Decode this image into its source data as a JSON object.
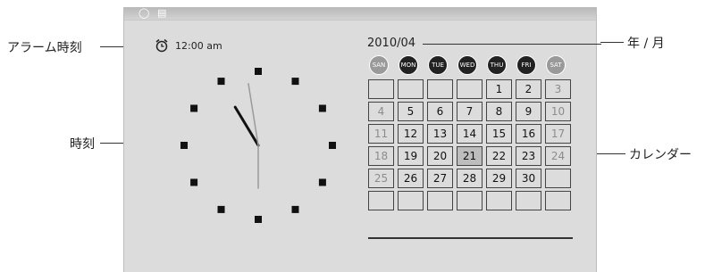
{
  "labels": {
    "alarm": "アラーム時刻",
    "clock": "時刻",
    "year_month": "年 / 月",
    "calendar": "カレンダー"
  },
  "status_icons": [
    "lightbulb-icon",
    "card-icon"
  ],
  "alarm": {
    "icon": "alarm-clock-icon",
    "time": "12:00 am"
  },
  "clock": {
    "hour": 10,
    "minute": 58,
    "second": 30
  },
  "calendar": {
    "year_month": "2010/04",
    "weekdays": [
      "SAN",
      "MON",
      "TUE",
      "WED",
      "THU",
      "FRI",
      "SAT"
    ],
    "weeks": [
      [
        "",
        "",
        "",
        "",
        "1",
        "2",
        "3"
      ],
      [
        "4",
        "5",
        "6",
        "7",
        "8",
        "9",
        "10"
      ],
      [
        "11",
        "12",
        "13",
        "14",
        "15",
        "16",
        "17"
      ],
      [
        "18",
        "19",
        "20",
        "21",
        "22",
        "23",
        "24"
      ],
      [
        "25",
        "26",
        "27",
        "28",
        "29",
        "30",
        ""
      ],
      [
        "",
        "",
        "",
        "",
        "",
        "",
        ""
      ]
    ],
    "today": "21"
  },
  "colors": {
    "screen": "#dcdcdc",
    "dark": "#222222",
    "weekend": "#8c8c8c",
    "today": "#bdbdbd"
  }
}
